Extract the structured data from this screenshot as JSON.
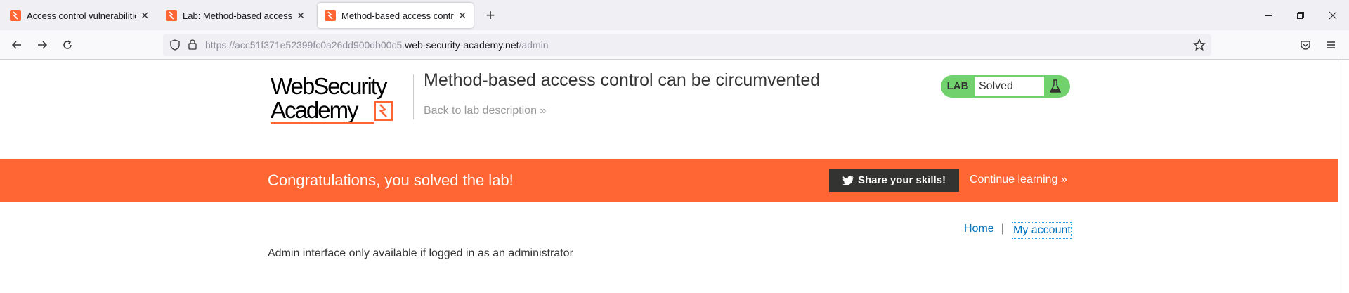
{
  "browser": {
    "tabs": [
      {
        "title": "Access control vulnerabilities an",
        "active": false
      },
      {
        "title": "Lab: Method-based access cont",
        "active": false
      },
      {
        "title": "Method-based access control c",
        "active": true
      }
    ],
    "new_tab_label": "+",
    "url_prefix": "https://acc51f371e52399fc0a26dd900db00c5.",
    "url_domain": "web-security-academy.net",
    "url_path": "/admin"
  },
  "header": {
    "logo_line1": "WebSecurity",
    "logo_line2": "Academy",
    "lab_title": "Method-based access control can be circumvented",
    "back_link": "Back to lab description",
    "back_chevrons": "»",
    "badge_label": "LAB",
    "badge_status": "Solved"
  },
  "banner": {
    "message": "Congratulations, you solved the lab!",
    "share_label": "Share your skills!",
    "continue_label": "Continue learning",
    "continue_chevrons": "»"
  },
  "nav": {
    "home": "Home",
    "separator": "|",
    "my_account": "My account"
  },
  "content": {
    "admin_message": "Admin interface only available if logged in as an administrator"
  },
  "colors": {
    "accent_orange": "#ff6633",
    "badge_green": "#70d16d",
    "link_blue": "#0071bc"
  }
}
